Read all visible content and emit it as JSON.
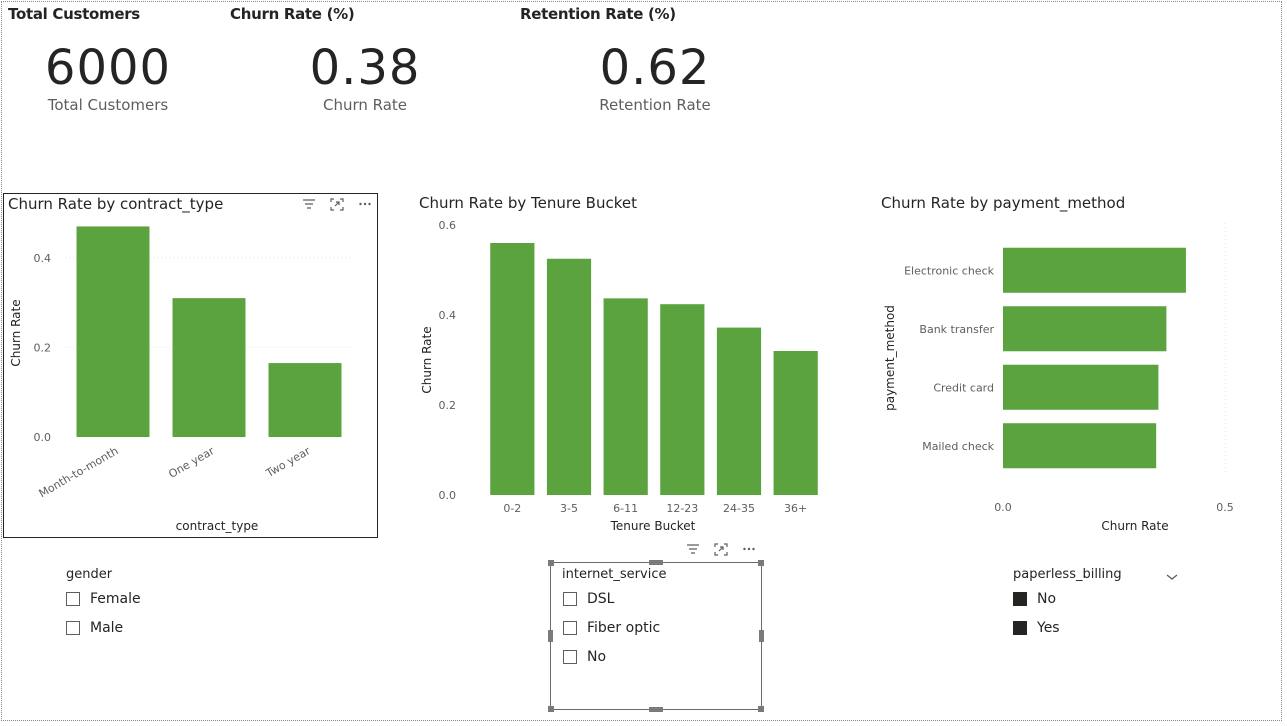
{
  "kpis": [
    {
      "header": "Total Customers",
      "value": "6000",
      "label": "Total Customers"
    },
    {
      "header": "Churn Rate (%)",
      "value": "0.38",
      "label": "Churn Rate"
    },
    {
      "header": "Retention Rate (%)",
      "value": "0.62",
      "label": "Retention Rate"
    }
  ],
  "charts": {
    "contract": {
      "title": "Churn Rate by contract_type"
    },
    "tenure": {
      "title": "Churn Rate by Tenure Bucket"
    },
    "payment": {
      "title": "Churn Rate by payment_method"
    }
  },
  "chart_data": [
    {
      "type": "bar",
      "title": "Churn Rate by contract_type",
      "xlabel": "contract_type",
      "ylabel": "Churn Rate",
      "categories": [
        "Month-to-month",
        "One year",
        "Two year"
      ],
      "values": [
        0.47,
        0.31,
        0.165
      ],
      "ylim": [
        0,
        0.5
      ],
      "yticks": [
        "0.0",
        "0.2",
        "0.4"
      ],
      "grid": true,
      "color": "#5aa33f"
    },
    {
      "type": "bar",
      "title": "Churn Rate by Tenure Bucket",
      "xlabel": "Tenure Bucket",
      "ylabel": "Churn Rate",
      "categories": [
        "0-2",
        "3-5",
        "6-11",
        "12-23",
        "24-35",
        "36+"
      ],
      "values": [
        0.56,
        0.525,
        0.437,
        0.424,
        0.372,
        0.32
      ],
      "ylim": [
        0,
        0.6
      ],
      "yticks": [
        "0.0",
        "0.2",
        "0.4",
        "0.6"
      ],
      "grid": false,
      "color": "#5aa33f"
    },
    {
      "type": "bar",
      "orientation": "horizontal",
      "title": "Churn Rate by payment_method",
      "xlabel": "Churn Rate",
      "ylabel": "payment_method",
      "categories": [
        "Electronic check",
        "Bank transfer",
        "Credit card",
        "Mailed check"
      ],
      "values": [
        0.412,
        0.368,
        0.35,
        0.345
      ],
      "xlim": [
        0,
        0.5
      ],
      "xticks": [
        "0.0",
        "0.5"
      ],
      "grid": true,
      "color": "#5aa33f"
    }
  ],
  "slicers": {
    "gender": {
      "title": "gender",
      "items": [
        {
          "label": "Female",
          "checked": false
        },
        {
          "label": "Male",
          "checked": false
        }
      ]
    },
    "internet": {
      "title": "internet_service",
      "items": [
        {
          "label": "DSL",
          "checked": false
        },
        {
          "label": "Fiber optic",
          "checked": false
        },
        {
          "label": "No",
          "checked": false
        }
      ]
    },
    "paperless": {
      "title": "paperless_billing",
      "items": [
        {
          "label": "No",
          "checked": true
        },
        {
          "label": "Yes",
          "checked": true
        }
      ]
    }
  },
  "icons": {
    "filter": "filter-icon",
    "focus": "focus-mode-icon",
    "more": "more-options-icon",
    "dropdown": "chevron-down-icon"
  },
  "colors": {
    "bar": "#5aa33f",
    "text": "#252423",
    "axis": "#605e5c"
  }
}
